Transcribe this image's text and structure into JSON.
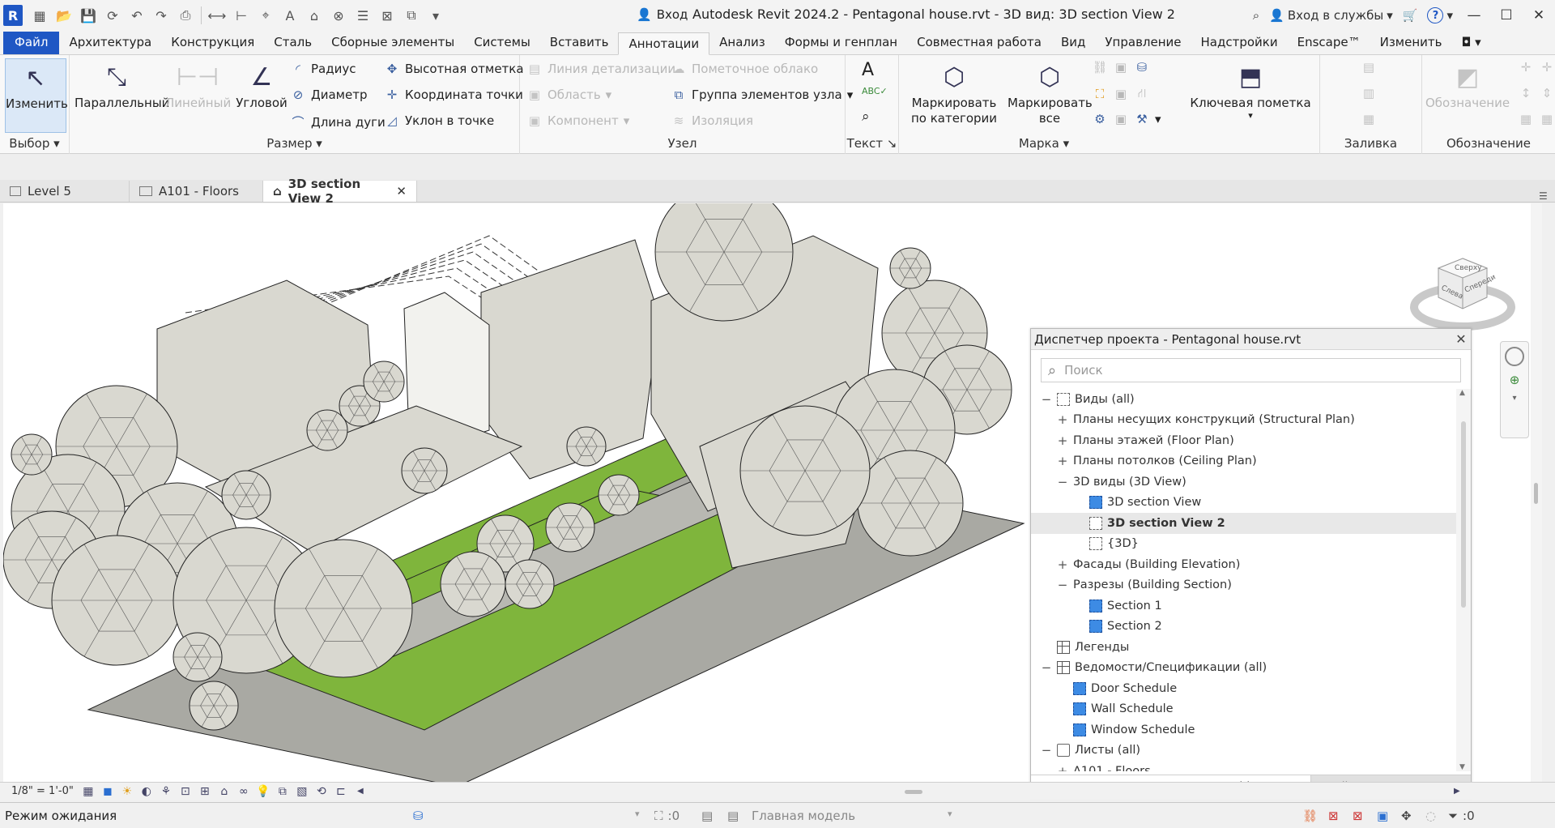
{
  "titlebar": {
    "app_logo": "R",
    "sign_in": "Вход",
    "title": "Autodesk Revit 2024.2 - Pentagonal house.rvt - 3D вид: 3D section View 2",
    "sign_in_services": "Вход в службы",
    "help": "?"
  },
  "menu": {
    "tabs": [
      "Файл",
      "Архитектура",
      "Конструкция",
      "Сталь",
      "Сборные элементы",
      "Системы",
      "Вставить",
      "Аннотации",
      "Анализ",
      "Формы и генплан",
      "Совместная работа",
      "Вид",
      "Управление",
      "Надстройки",
      "Enscape™",
      "Изменить"
    ],
    "active_index": 7
  },
  "ribbon": {
    "select_panel": {
      "label": "Выбор",
      "modify": "Изменить"
    },
    "dimension_panel": {
      "label": "Размер",
      "aligned": "Параллельный",
      "linear": "Линейный",
      "angular": "Угловой",
      "radial": "Радиус",
      "diameter": "Диаметр",
      "arc_length": "Длина дуги",
      "spot_elevation": "Высотная отметка",
      "spot_coordinate": "Координата точки",
      "spot_slope": "Уклон  в точке"
    },
    "detail_panel": {
      "label": "Узел",
      "detail_line": "Линия детализации",
      "region": "Область",
      "component": "Компонент",
      "revision_cloud": "Пометочное облако",
      "detail_group": "Группа элементов узла",
      "insulation": "Изоляция"
    },
    "text_panel": {
      "label": "Текст"
    },
    "tag_panel": {
      "label": "Марка",
      "tag_by_category": "Маркировать по категории",
      "tag_all": "Маркировать все"
    },
    "keynote": {
      "label": "Ключевая пометка"
    },
    "color_fill": {
      "label": "Заливка цветом"
    },
    "symbol_panel": {
      "label": "Обозначение",
      "symbol": "Обозначение"
    }
  },
  "view_tabs": [
    {
      "label": "Level 5",
      "active": false
    },
    {
      "label": "A101 - Floors",
      "active": false
    },
    {
      "label": "3D section View 2",
      "active": true
    }
  ],
  "browser": {
    "title": "Диспетчер проекта - Pentagonal house.rvt",
    "search_placeholder": "Поиск",
    "nodes": [
      {
        "label": "Виды (all)",
        "level": 0,
        "toggle": "−",
        "icon": "views"
      },
      {
        "label": "Планы несущих конструкций (Structural Plan)",
        "level": 1,
        "toggle": "+",
        "icon": ""
      },
      {
        "label": "Планы этажей (Floor Plan)",
        "level": 1,
        "toggle": "+",
        "icon": ""
      },
      {
        "label": "Планы потолков (Ceiling Plan)",
        "level": 1,
        "toggle": "+",
        "icon": ""
      },
      {
        "label": "3D виды (3D View)",
        "level": 1,
        "toggle": "−",
        "icon": ""
      },
      {
        "label": "3D section View",
        "level": 2,
        "toggle": "",
        "icon": "view"
      },
      {
        "label": "3D section View 2",
        "level": 2,
        "toggle": "",
        "icon": "view3d",
        "selected": true
      },
      {
        "label": "{3D}",
        "level": 2,
        "toggle": "",
        "icon": "view3d"
      },
      {
        "label": "Фасады (Building Elevation)",
        "level": 1,
        "toggle": "+",
        "icon": ""
      },
      {
        "label": "Разрезы (Building Section)",
        "level": 1,
        "toggle": "−",
        "icon": ""
      },
      {
        "label": "Section 1",
        "level": 2,
        "toggle": "",
        "icon": "view"
      },
      {
        "label": "Section 2",
        "level": 2,
        "toggle": "",
        "icon": "view"
      },
      {
        "label": "Легенды",
        "level": 0,
        "toggle": "",
        "icon": "grid"
      },
      {
        "label": "Ведомости/Спецификации (all)",
        "level": 0,
        "toggle": "−",
        "icon": "grid"
      },
      {
        "label": "Door Schedule",
        "level": 1,
        "toggle": "",
        "icon": "view"
      },
      {
        "label": "Wall Schedule",
        "level": 1,
        "toggle": "",
        "icon": "view"
      },
      {
        "label": "Window Schedule",
        "level": 1,
        "toggle": "",
        "icon": "view"
      },
      {
        "label": "Листы (all)",
        "level": 0,
        "toggle": "−",
        "icon": "folder"
      },
      {
        "label": "A101 - Floors",
        "level": 1,
        "toggle": "+",
        "icon": ""
      }
    ],
    "footer_tabs": [
      "Диспетчер проекта - Pentagonal house.rvt",
      "Свойства"
    ]
  },
  "view_control": {
    "scale": "1/8\" = 1'-0\""
  },
  "status": {
    "text": "Режим ожидания",
    "counter": ":0",
    "model": "Главная модель",
    "filter_count": ":0"
  },
  "viewcube": {
    "top": "Сверху",
    "front": "Спереди",
    "left": "Слева"
  },
  "colors": {
    "accent": "#1f57c4",
    "grass": "#7fb53c",
    "massing": "#d9d8d0"
  }
}
